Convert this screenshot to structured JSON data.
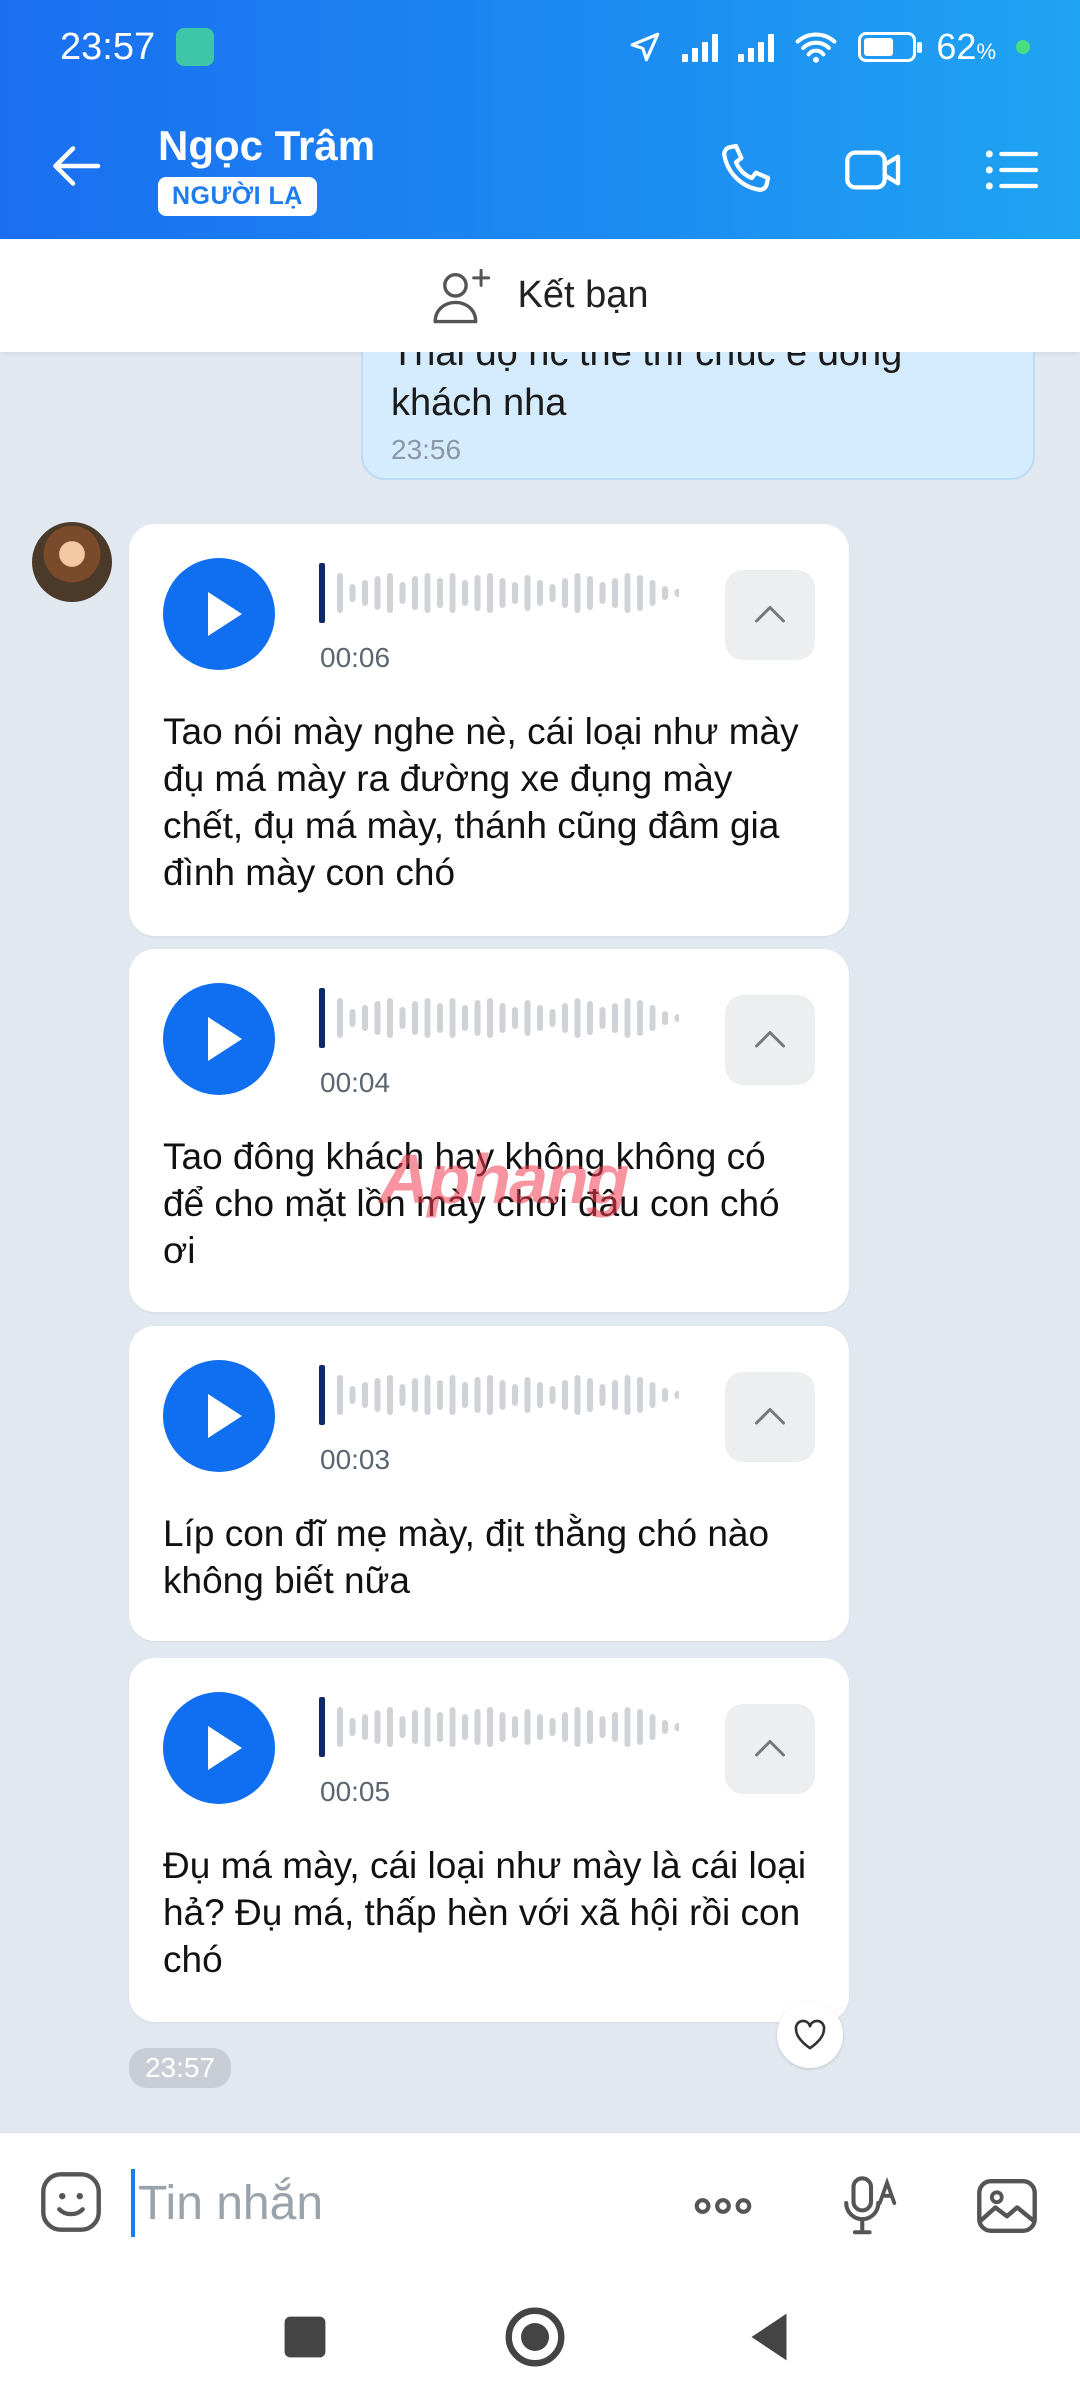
{
  "status_bar": {
    "time": "23:57",
    "battery_percent": "62",
    "battery_unit": "%",
    "battery_level": 0.62
  },
  "header": {
    "contact_name": "Ngọc Trâm",
    "badge": "NGƯỜI LẠ",
    "icons": [
      "back-arrow-icon",
      "phone-icon",
      "video-call-icon",
      "menu-list-icon"
    ]
  },
  "add_friend": {
    "label": "Kết bạn",
    "icon": "add-person-icon"
  },
  "sent_message": {
    "text": "Thái độ nc thế thì chúc e đông khách nha",
    "time": "23:56"
  },
  "voice_messages": [
    {
      "duration": "00:06",
      "transcript": "Tao nói mày nghe nè, cái loại như mày đụ má mày ra đường xe đụng mày chết, đụ má mày, thánh cũng đâm gia đình mày con chó"
    },
    {
      "duration": "00:04",
      "transcript": "Tao đông khách hay không không có để cho mặt lồn mày chơi đâu con chó ơi"
    },
    {
      "duration": "00:03",
      "transcript": "Líp con đĩ mẹ mày, địt thằng chó nào không biết nữa"
    },
    {
      "duration": "00:05",
      "transcript": "Đụ má mày, cái loại như mày là cái loại hả? Đụ má, thấp hèn với xã hội rồi con chó"
    }
  ],
  "received_time": "23:57",
  "watermark": "Aphang",
  "input": {
    "placeholder": "Tin nhắn",
    "value": ""
  },
  "colors": {
    "accent": "#0f6ff0",
    "header_start": "#1a6ff0",
    "header_end": "#1fa4f2",
    "sent_bubble": "#d4ecfd"
  }
}
